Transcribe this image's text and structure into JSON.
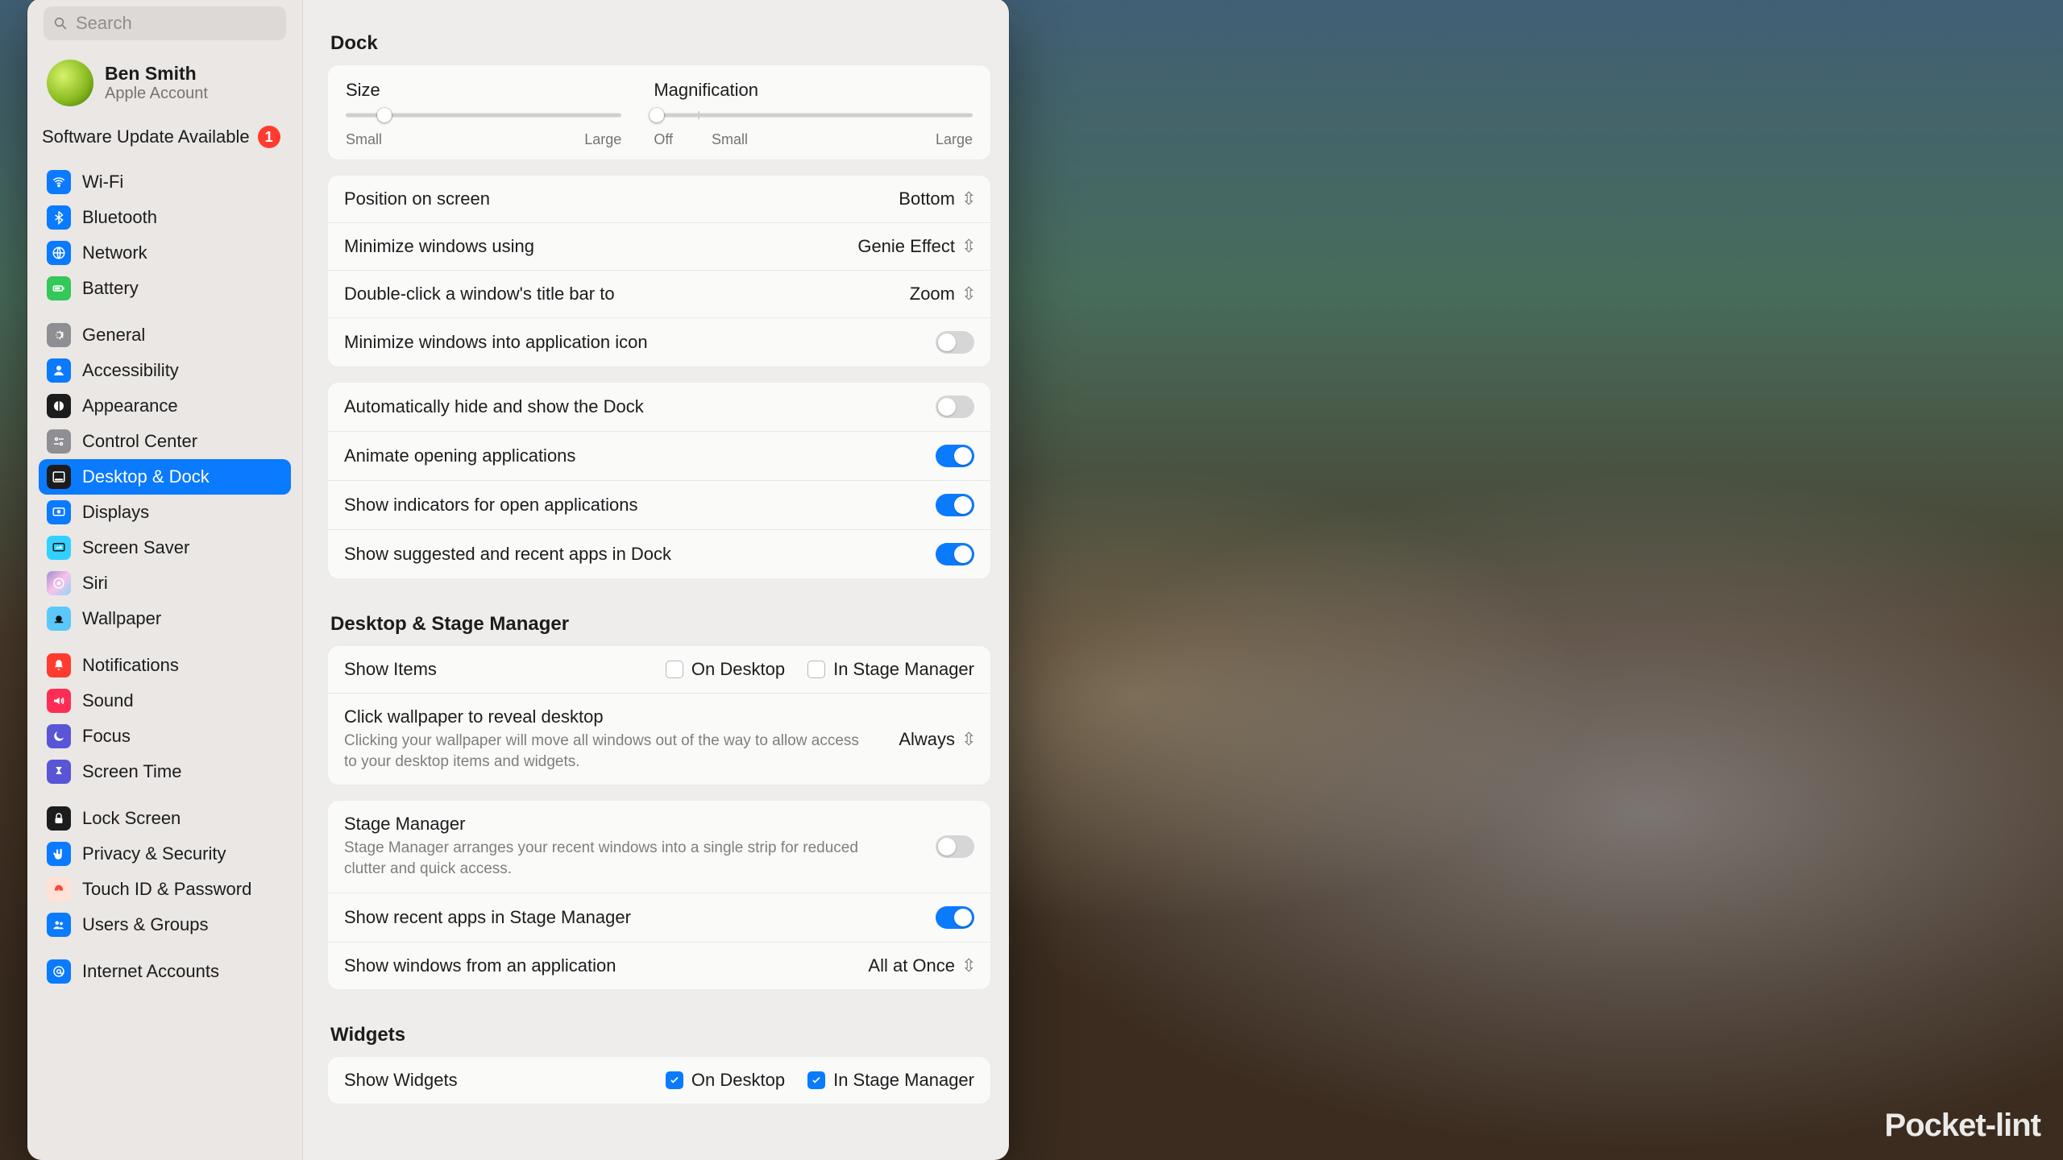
{
  "watermark": "Pocket-lint",
  "search": {
    "placeholder": "Search"
  },
  "account": {
    "name": "Ben Smith",
    "sub": "Apple Account"
  },
  "software_update": {
    "text": "Software Update Available",
    "badge": "1"
  },
  "sidebar": {
    "items": [
      {
        "id": "wifi",
        "label": "Wi-Fi",
        "iconClass": "icon-blue",
        "glyph": "wifi"
      },
      {
        "id": "bluetooth",
        "label": "Bluetooth",
        "iconClass": "icon-blue",
        "glyph": "bluetooth"
      },
      {
        "id": "network",
        "label": "Network",
        "iconClass": "icon-blue",
        "glyph": "globe"
      },
      {
        "id": "battery",
        "label": "Battery",
        "iconClass": "icon-green",
        "glyph": "battery"
      },
      {
        "spacer": true
      },
      {
        "id": "general",
        "label": "General",
        "iconClass": "icon-grey",
        "glyph": "gear"
      },
      {
        "id": "accessibility",
        "label": "Accessibility",
        "iconClass": "icon-blue",
        "glyph": "person"
      },
      {
        "id": "appearance",
        "label": "Appearance",
        "iconClass": "icon-black",
        "glyph": "appearance"
      },
      {
        "id": "control-center",
        "label": "Control Center",
        "iconClass": "icon-grey",
        "glyph": "cc"
      },
      {
        "id": "desktop-dock",
        "label": "Desktop & Dock",
        "iconClass": "icon-black",
        "glyph": "dock",
        "selected": true
      },
      {
        "id": "displays",
        "label": "Displays",
        "iconClass": "icon-blue",
        "glyph": "display"
      },
      {
        "id": "screen-saver",
        "label": "Screen Saver",
        "iconClass": "icon-cyan",
        "glyph": "screensaver"
      },
      {
        "id": "siri",
        "label": "Siri",
        "iconClass": "icon-grad",
        "glyph": "siri"
      },
      {
        "id": "wallpaper",
        "label": "Wallpaper",
        "iconClass": "icon-teal",
        "glyph": "wallpaper"
      },
      {
        "spacer": true
      },
      {
        "id": "notifications",
        "label": "Notifications",
        "iconClass": "icon-red",
        "glyph": "bell"
      },
      {
        "id": "sound",
        "label": "Sound",
        "iconClass": "icon-pink",
        "glyph": "sound"
      },
      {
        "id": "focus",
        "label": "Focus",
        "iconClass": "icon-indigo",
        "glyph": "moon"
      },
      {
        "id": "screen-time",
        "label": "Screen Time",
        "iconClass": "icon-indigo",
        "glyph": "hourglass"
      },
      {
        "spacer": true
      },
      {
        "id": "lock-screen",
        "label": "Lock Screen",
        "iconClass": "icon-black",
        "glyph": "lock"
      },
      {
        "id": "privacy",
        "label": "Privacy & Security",
        "iconClass": "icon-blue",
        "glyph": "hand"
      },
      {
        "id": "touchid",
        "label": "Touch ID & Password",
        "iconClass": "icon-flesh",
        "glyph": "finger"
      },
      {
        "id": "users",
        "label": "Users & Groups",
        "iconClass": "icon-blue",
        "glyph": "users"
      },
      {
        "spacer": true
      },
      {
        "id": "internet-accts",
        "label": "Internet Accounts",
        "iconClass": "icon-blue",
        "glyph": "at"
      }
    ]
  },
  "dock": {
    "title": "Dock",
    "size": {
      "label": "Size",
      "min": "Small",
      "max": "Large",
      "valuePct": 14
    },
    "mag": {
      "label": "Magnification",
      "off": "Off",
      "min": "Small",
      "max": "Large",
      "valuePct": 1
    },
    "position": {
      "label": "Position on screen",
      "value": "Bottom"
    },
    "minimize": {
      "label": "Minimize windows using",
      "value": "Genie Effect"
    },
    "dblclick": {
      "label": "Double-click a window's title bar to",
      "value": "Zoom"
    },
    "minAppIcon": {
      "label": "Minimize windows into application icon",
      "on": false
    },
    "autohide": {
      "label": "Automatically hide and show the Dock",
      "on": false
    },
    "animate": {
      "label": "Animate opening applications",
      "on": true
    },
    "indicators": {
      "label": "Show indicators for open applications",
      "on": true
    },
    "suggested": {
      "label": "Show suggested and recent apps in Dock",
      "on": true
    }
  },
  "stage": {
    "title": "Desktop & Stage Manager",
    "showItems": {
      "label": "Show Items",
      "onDesktop": "On Desktop",
      "inStage": "In Stage Manager",
      "desktopChecked": false,
      "stageChecked": false
    },
    "reveal": {
      "label": "Click wallpaper to reveal desktop",
      "value": "Always",
      "sub": "Clicking your wallpaper will move all windows out of the way to allow access to your desktop items and widgets."
    },
    "stageManager": {
      "label": "Stage Manager",
      "on": false,
      "sub": "Stage Manager arranges your recent windows into a single strip for reduced clutter and quick access."
    },
    "recentInStage": {
      "label": "Show recent apps in Stage Manager",
      "on": true
    },
    "showFromApp": {
      "label": "Show windows from an application",
      "value": "All at Once"
    }
  },
  "widgets": {
    "title": "Widgets",
    "showWidgets": {
      "label": "Show Widgets",
      "onDesktop": "On Desktop",
      "inStage": "In Stage Manager",
      "desktopChecked": true,
      "stageChecked": true
    }
  }
}
